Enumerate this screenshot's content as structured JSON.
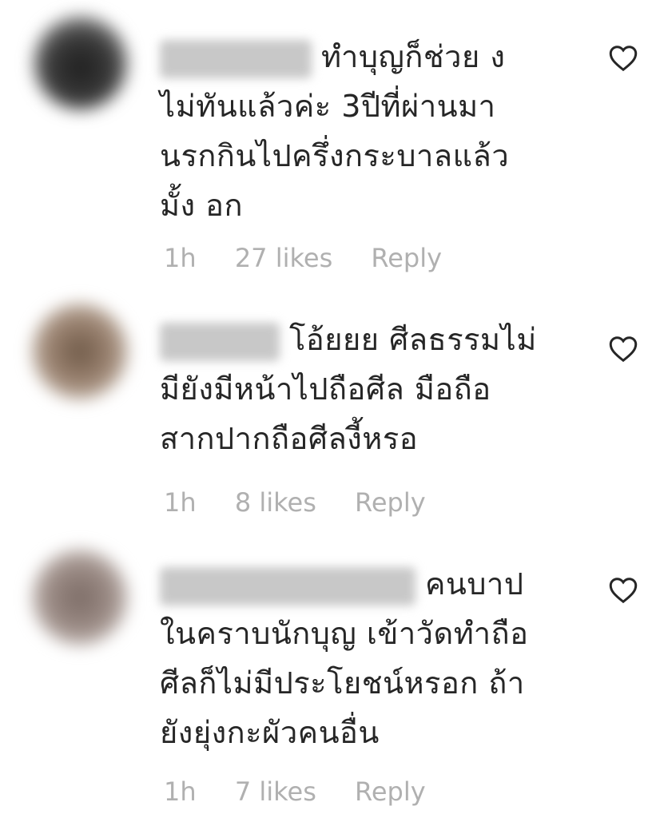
{
  "comments": [
    {
      "lines": [
        "ทำบุญก็ช่วย ง",
        "ไม่ทันแล้วค่ะ 3ปีที่ผ่านมา",
        "นรกกินไปครึ่งกระบาลแล้ว",
        "มั้ง อก"
      ],
      "time": "1h",
      "likes": "27 likes",
      "reply": "Reply",
      "avatar_color": "#3a3a3a"
    },
    {
      "lines": [
        "โอ้ยยย ศีลธรรมไม่",
        "มียังมีหน้าไปถือศีล มือถือ",
        "สากปากถือศีลงี้หรอ"
      ],
      "time": "1h",
      "likes": "8 likes",
      "reply": "Reply",
      "avatar_color": "#9a8270"
    },
    {
      "lines": [
        "คนบาป",
        "ในคราบนักบุญ เข้าวัดทำถือ",
        "ศีลก็ไม่มีประโยชน์หรอก ถ้า",
        "ยังยุ่งกะผัวคนอื่น"
      ],
      "time": "1h",
      "likes": "7 likes",
      "reply": "Reply",
      "avatar_color": "#9a8a84"
    }
  ],
  "icons": {
    "like": "heart-icon"
  }
}
